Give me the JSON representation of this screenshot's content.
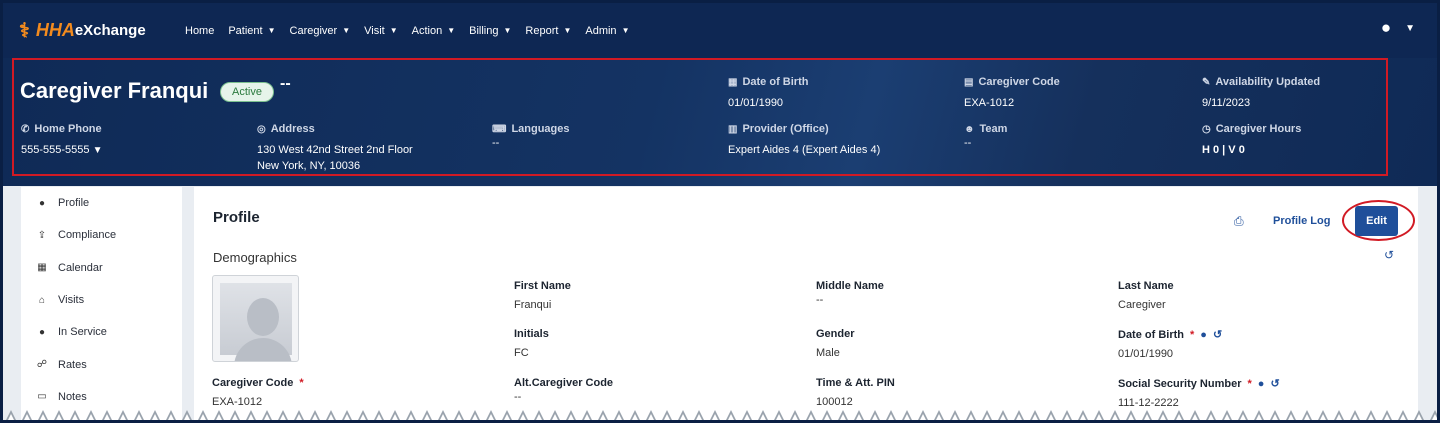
{
  "app": {
    "logo_mark": "⚕",
    "logo_hha": "HHA",
    "logo_rest": "eXchange"
  },
  "nav": {
    "items": [
      {
        "label": "Home",
        "caret": false
      },
      {
        "label": "Patient",
        "caret": true
      },
      {
        "label": "Caregiver",
        "caret": true
      },
      {
        "label": "Visit",
        "caret": true
      },
      {
        "label": "Action",
        "caret": true
      },
      {
        "label": "Billing",
        "caret": true
      },
      {
        "label": "Report",
        "caret": true
      },
      {
        "label": "Admin",
        "caret": true
      }
    ]
  },
  "header": {
    "name": "Caregiver Franqui",
    "status": "Active",
    "suffix": "--",
    "dob_label": "Date of Birth",
    "dob": "01/01/1990",
    "code_label": "Caregiver Code",
    "code": "EXA-1012",
    "avail_label": "Availability Updated",
    "avail": "9/11/2023",
    "phone_label": "Home Phone",
    "phone": "555-555-5555",
    "address_label": "Address",
    "address_line1": "130 West 42nd Street 2nd Floor",
    "address_line2": "New York, NY, 10036",
    "lang_label": "Languages",
    "lang": "--",
    "provider_label": "Provider (Office)",
    "provider": "Expert Aides 4 (Expert Aides 4)",
    "team_label": "Team",
    "team": "--",
    "hours_label": "Caregiver Hours",
    "hours": "H 0 | V 0"
  },
  "sidebar": {
    "items": [
      {
        "label": "Profile",
        "icon": "person-icon"
      },
      {
        "label": "Compliance",
        "icon": "upload-icon"
      },
      {
        "label": "Calendar",
        "icon": "calendar-icon"
      },
      {
        "label": "Visits",
        "icon": "home-icon"
      },
      {
        "label": "In Service",
        "icon": "circle-icon"
      },
      {
        "label": "Rates",
        "icon": "handshake-icon"
      },
      {
        "label": "Notes",
        "icon": "note-icon"
      }
    ]
  },
  "profile": {
    "title": "Profile",
    "section": "Demographics",
    "profile_log": "Profile Log",
    "edit": "Edit",
    "first_name_label": "First Name",
    "first_name": "Franqui",
    "middle_name_label": "Middle Name",
    "middle_name": "--",
    "last_name_label": "Last Name",
    "last_name": "Caregiver",
    "initials_label": "Initials",
    "initials": "FC",
    "gender_label": "Gender",
    "gender": "Male",
    "dob_label": "Date of Birth",
    "dob": "01/01/1990",
    "code_label": "Caregiver Code",
    "code": "EXA-1012",
    "alt_code_label": "Alt.Caregiver Code",
    "alt_code": "--",
    "pin_label": "Time & Att. PIN",
    "pin": "100012",
    "ssn_label": "Social Security Number",
    "ssn": "111-12-2222",
    "required_mark": "*"
  },
  "colors": {
    "nav_bg": "#0e2753",
    "accent": "#1f4f9a",
    "highlight": "#d11a24",
    "active_badge": "#2b7a3e"
  }
}
